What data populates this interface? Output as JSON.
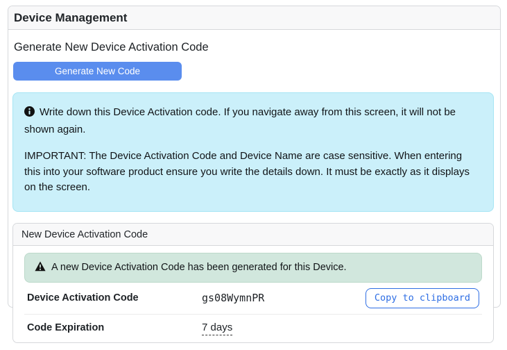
{
  "page": {
    "title": "Device Management"
  },
  "generate": {
    "heading": "Generate New Device Activation Code",
    "button_label": "Generate New Code"
  },
  "info_alert": {
    "icon": "info-circle-icon",
    "line1": "Write down this Device Activation code. If you navigate away from this screen, it will not be shown again.",
    "line2": "IMPORTANT: The Device Activation Code and Device Name are case sensitive. When entering this into your software product ensure you write the details down. It must be exactly as it displays on the screen."
  },
  "code_card": {
    "header": "New Device Activation Code",
    "success_alert": {
      "icon": "warning-triangle-icon",
      "text": "A new Device Activation Code has been generated for this Device."
    },
    "rows": [
      {
        "label": "Device Activation Code",
        "value": "gs08WymnPR",
        "action": "Copy to clipboard"
      },
      {
        "label": "Code Expiration",
        "value": "7 days"
      }
    ]
  },
  "colors": {
    "primary_button": "#5a8dee",
    "copy_button_blue": "#2e6ee4",
    "info_alert_bg": "#cbf0fa",
    "success_alert_bg": "#d1e7dd",
    "card_header_bg": "#f8f8f9",
    "card_border": "#d6d8db"
  }
}
